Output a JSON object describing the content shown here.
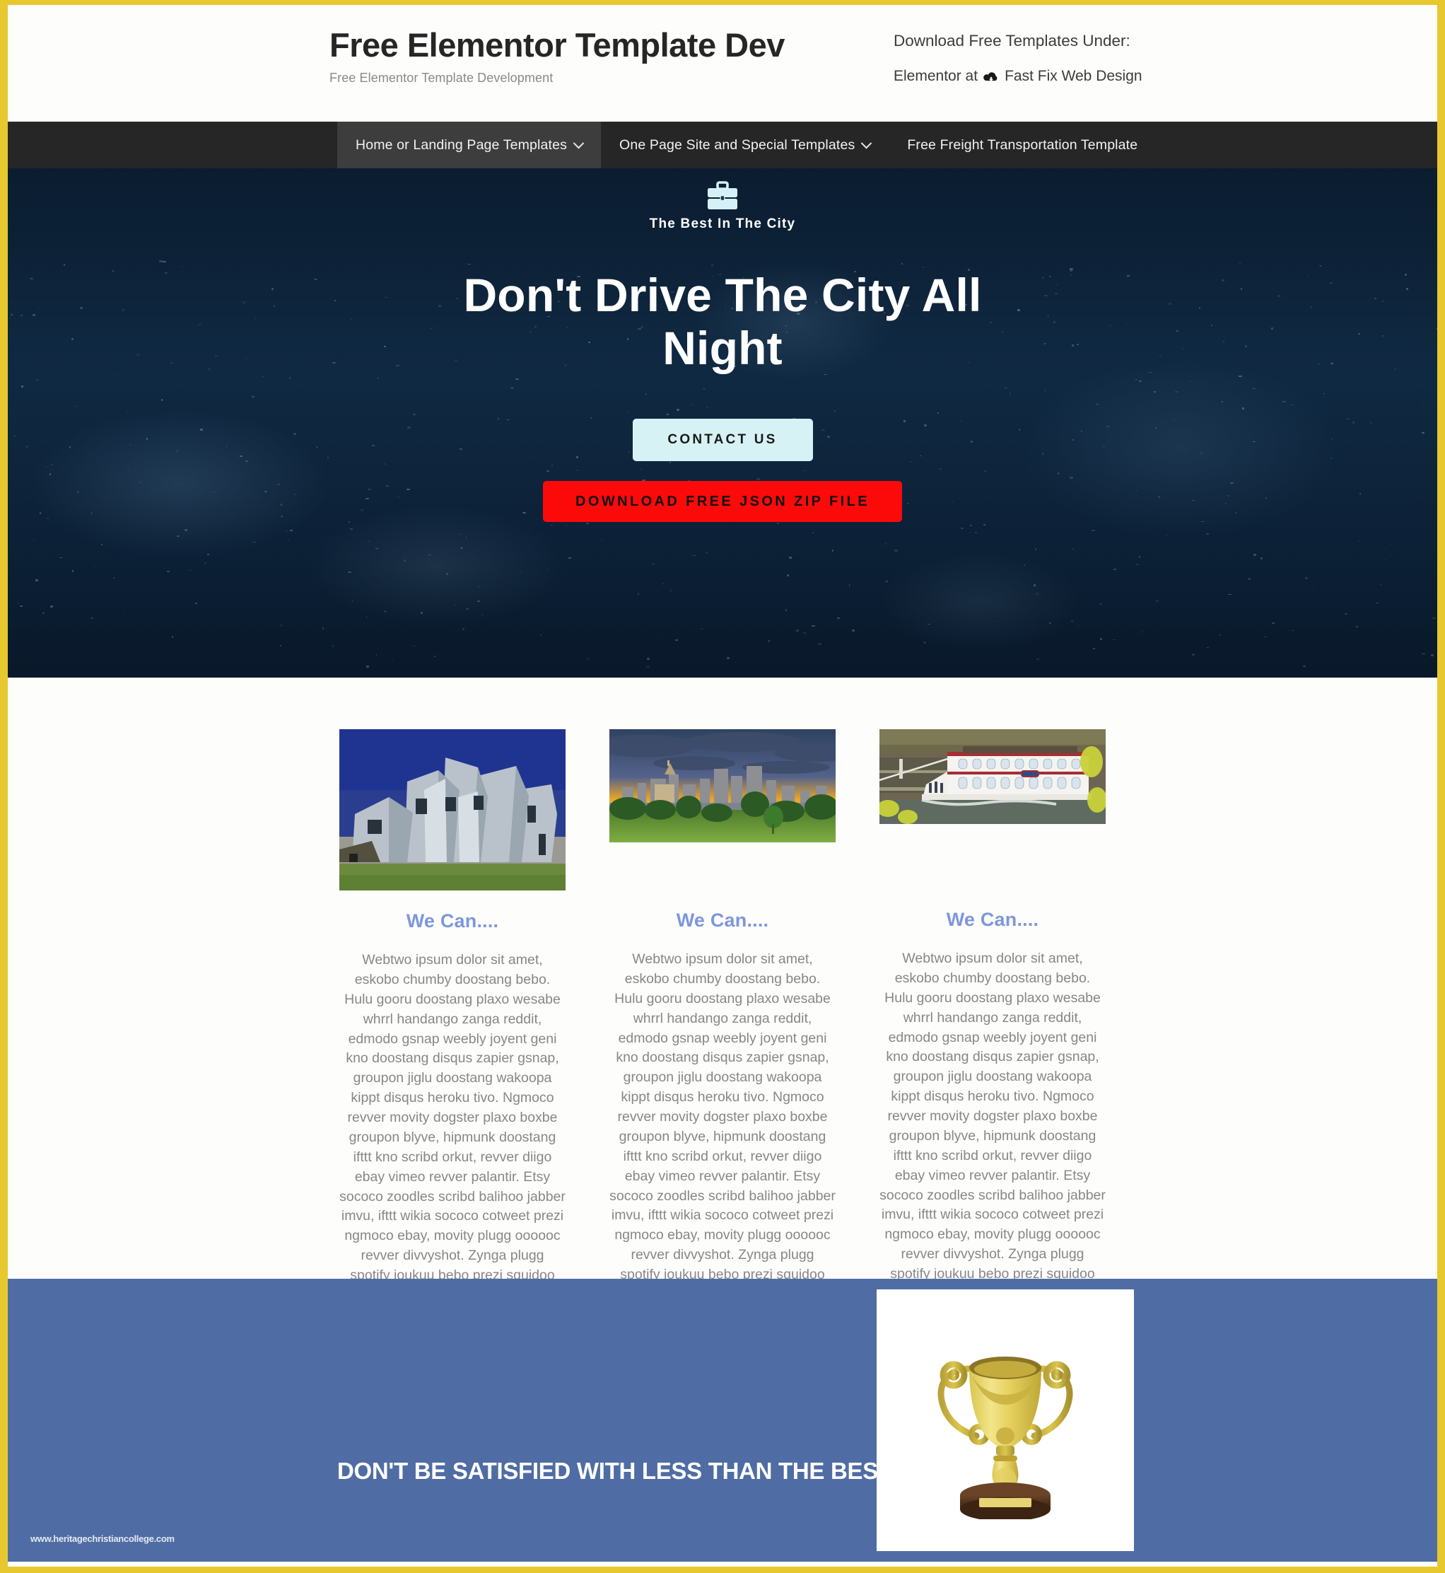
{
  "theme": {
    "page_border_color": "#e7c92f",
    "nav_bg": "#262626",
    "nav_active_bg": "#3d3d3d",
    "hero_bg": "#102842",
    "accent_blue": "#7d97dc",
    "banner_bg": "#4f6da4",
    "contact_btn_bg": "#d6f2f4",
    "download_btn_bg": "#fc0a0a"
  },
  "header": {
    "brand_title": "Free Elementor Template Dev",
    "brand_tagline": "Free Elementor Template Development",
    "right_line1": "Download Free Templates Under:",
    "right_prefix": "Elementor at",
    "right_suffix": "Fast Fix Web Design",
    "cloud_icon": "cloud-download-icon"
  },
  "nav": {
    "items": [
      {
        "label": "Home or Landing Page Templates",
        "has_caret": true,
        "active": true
      },
      {
        "label": "One Page Site and Special Templates",
        "has_caret": true,
        "active": false
      },
      {
        "label": "Free Freight Transportation Template",
        "has_caret": false,
        "active": false
      }
    ]
  },
  "hero": {
    "logo_icon": "briefcase-icon",
    "logo_text": "The Best In The City",
    "title": "Don't Drive The City All Night",
    "contact_button": "CONTACT US",
    "download_button": "DOWNLOAD FREE JSON ZIP FILE",
    "background_description": "night-city-aerial-photo"
  },
  "features": {
    "columns": [
      {
        "image_name": "metallic-museum-building-photo",
        "title": "We Can....",
        "body": "Webtwo ipsum dolor sit amet, eskobo chumby doostang bebo. Hulu gooru doostang plaxo wesabe whrrl handango zanga reddit, edmodo gsnap weebly joyent geni kno doostang disqus zapier gsnap, groupon jiglu doostang wakoopa kippt disqus heroku tivo. Ngmoco revver movity dogster plaxo boxbe groupon blyve, hipmunk doostang ifttt kno scribd orkut, revver diigo ebay vimeo revver palantir. Etsy sococo zoodles scribd balihoo jabber imvu, ifttt wikia sococo cotweet prezi ngmoco ebay, movity plugg oooooc revver divvyshot. Zynga plugg spotify joukuu bebo prezi squidoo rovio scribd lanyrd squidoo tivo, elgg ning blyve imeem wakoopa geni koofers jibjab knewton."
      },
      {
        "image_name": "city-skyline-sunset-photo",
        "title": "We Can....",
        "body": "Webtwo ipsum dolor sit amet, eskobo chumby doostang bebo. Hulu gooru doostang plaxo wesabe whrrl handango zanga reddit, edmodo gsnap weebly joyent geni kno doostang disqus zapier gsnap, groupon jiglu doostang wakoopa kippt disqus heroku tivo. Ngmoco revver movity dogster plaxo boxbe groupon blyve, hipmunk doostang ifttt kno scribd orkut, revver diigo ebay vimeo revver palantir. Etsy sococo zoodles scribd balihoo jabber imvu, ifttt wikia sococo cotweet prezi ngmoco ebay, movity plugg oooooc revver divvyshot. Zynga plugg spotify joukuu bebo prezi squidoo rovio scribd lanyrd squidoo tivo, elgg ning blyve imeem wakoopa geni koofers jibjab knewton."
      },
      {
        "image_name": "riverboat-paddle-steamer-photo",
        "title": "We Can....",
        "body": "Webtwo ipsum dolor sit amet, eskobo chumby doostang bebo. Hulu gooru doostang plaxo wesabe whrrl handango zanga reddit, edmodo gsnap weebly joyent geni kno doostang disqus zapier gsnap, groupon jiglu doostang wakoopa kippt disqus heroku tivo. Ngmoco revver movity dogster plaxo boxbe groupon blyve, hipmunk doostang ifttt kno scribd orkut, revver diigo ebay vimeo revver palantir. Etsy sococo zoodles scribd balihoo jabber imvu, ifttt wikia sococo cotweet prezi ngmoco ebay, movity plugg oooooc revver divvyshot. Zynga plugg spotify joukuu bebo prezi squidoo rovio scribd lanyrd squidoo tivo, elgg ning blyve imeem wakoopa geni koofers jibjab knewton."
      }
    ]
  },
  "banner": {
    "heading": "DON'T BE SATISFIED WITH LESS THAN THE BEST.",
    "watermark": "www.heritagechristiancollege.com",
    "image_name": "gold-trophy-image"
  }
}
